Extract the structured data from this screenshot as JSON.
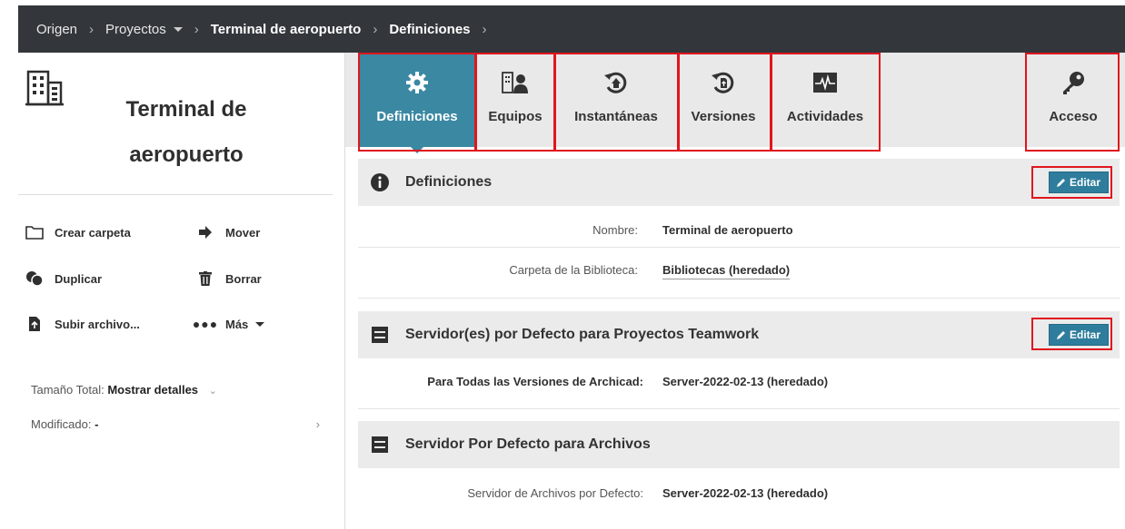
{
  "breadcrumb": {
    "items": [
      "Origen",
      "Proyectos",
      "Terminal de aeropuerto",
      "Definiciones"
    ]
  },
  "project": {
    "title_line1": "Terminal de",
    "title_line2": "aeropuerto"
  },
  "actions": {
    "create_folder": "Crear carpeta",
    "move": "Mover",
    "duplicate": "Duplicar",
    "delete": "Borrar",
    "upload": "Subir archivo...",
    "more": "Más"
  },
  "meta": {
    "total_size_label": "Tamaño Total:",
    "total_size_value": "Mostrar detalles",
    "modified_label": "Modificado:",
    "modified_value": "-"
  },
  "tabs": [
    {
      "label": "Definiciones",
      "icon": "gear-icon",
      "active": true
    },
    {
      "label": "Equipos",
      "icon": "team-icon"
    },
    {
      "label": "Instantáneas",
      "icon": "snapshot-icon"
    },
    {
      "label": "Versiones",
      "icon": "versions-icon"
    },
    {
      "label": "Actividades",
      "icon": "activity-icon"
    },
    {
      "label": "Acceso",
      "icon": "key-icon"
    }
  ],
  "sections": {
    "definitions": {
      "title": "Definiciones",
      "edit_label": "Editar",
      "name_label": "Nombre:",
      "name_value": "Terminal de aeropuerto",
      "library_label": "Carpeta de la Biblioteca:",
      "library_value": "Bibliotecas (heredado)"
    },
    "teamwork": {
      "title": "Servidor(es) por Defecto para Proyectos Teamwork",
      "edit_label": "Editar",
      "versions_label": "Para Todas las Versiones de Archicad:",
      "versions_value": "Server-2022-02-13 (heredado)"
    },
    "files": {
      "title": "Servidor Por Defecto para Archivos",
      "server_label": "Servidor de Archivos por Defecto:",
      "server_value": "Server-2022-02-13 (heredado)"
    }
  },
  "colors": {
    "accent": "#3b88a3",
    "topbar": "#33373b",
    "highlight": "#e0161e"
  }
}
